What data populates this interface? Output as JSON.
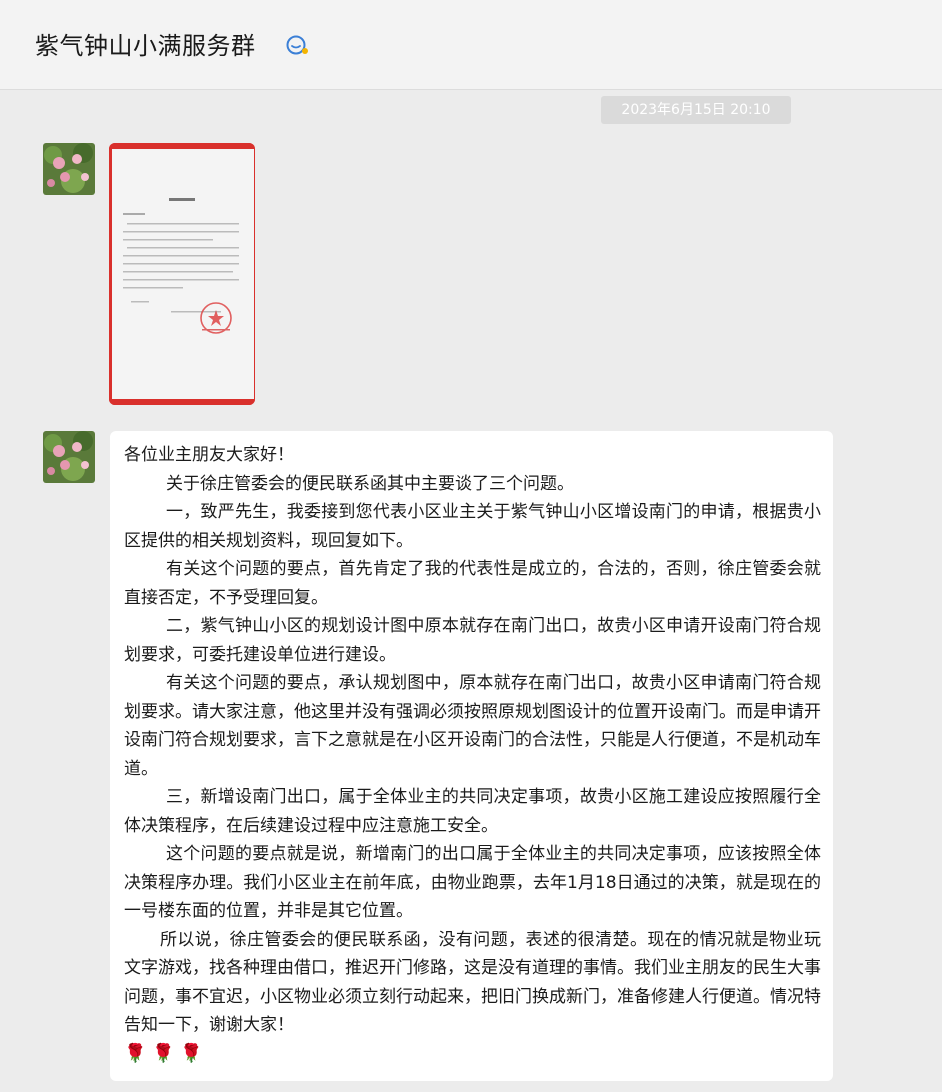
{
  "header": {
    "title": "紫气钟山小满服务群"
  },
  "timestamp": "2023年6月15日 20:10",
  "messages": {
    "image": {
      "document_heading": "便民联系函"
    },
    "text": {
      "paragraphs": [
        "各位业主朋友大家好！",
        "关于徐庄管委会的便民联系函其中主要谈了三个问题。",
        "一，致严先生，我委接到您代表小区业主关于紫气钟山小区增设南门的申请，根据贵小区提供的相关规划资料，现回复如下。",
        "有关这个问题的要点，首先肯定了我的代表性是成立的，合法的，否则，徐庄管委会就直接否定，不予受理回复。",
        "二，紫气钟山小区的规划设计图中原本就存在南门出口，故贵小区申请开设南门符合规划要求，可委托建设单位进行建设。",
        "有关这个问题的要点，承认规划图中，原本就存在南门出口，故贵小区申请南门符合规划要求。请大家注意，他这里并没有强调必须按照原规划图设计的位置开设南门。而是申请开设南门符合规划要求，言下之意就是在小区开设南门的合法性，只能是人行便道，不是机动车道。",
        "三，新增设南门出口，属于全体业主的共同决定事项，故贵小区施工建设应按照履行全体决策程序，在后续建设过程中应注意施工安全。",
        "这个问题的要点就是说，新增南门的出口属于全体业主的共同决定事项，应该按照全体决策程序办理。我们小区业主在前年底，由物业跑票，去年1月18日通过的决策，就是现在的一号楼东面的位置，并非是其它位置。",
        "所以说，徐庄管委会的便民联系函，没有问题，表述的很清楚。现在的情况就是物业玩文字游戏，找各种理由借口，推迟开门修路，这是没有道理的事情。我们业主朋友的民生大事问题，事不宜迟，小区物业必须立刻行动起来，把旧门换成新门，准备修建人行便道。情况特告知一下，谢谢大家！"
      ],
      "emojis": "🌹 🌹 🌹"
    }
  },
  "colors": {
    "background": "#ececec",
    "bubble": "#ffffff",
    "accent_icon": "#3b7fd6",
    "timestamp_bg": "#dadada"
  },
  "icons": [
    "group-service-icon",
    "rose-emoji"
  ]
}
